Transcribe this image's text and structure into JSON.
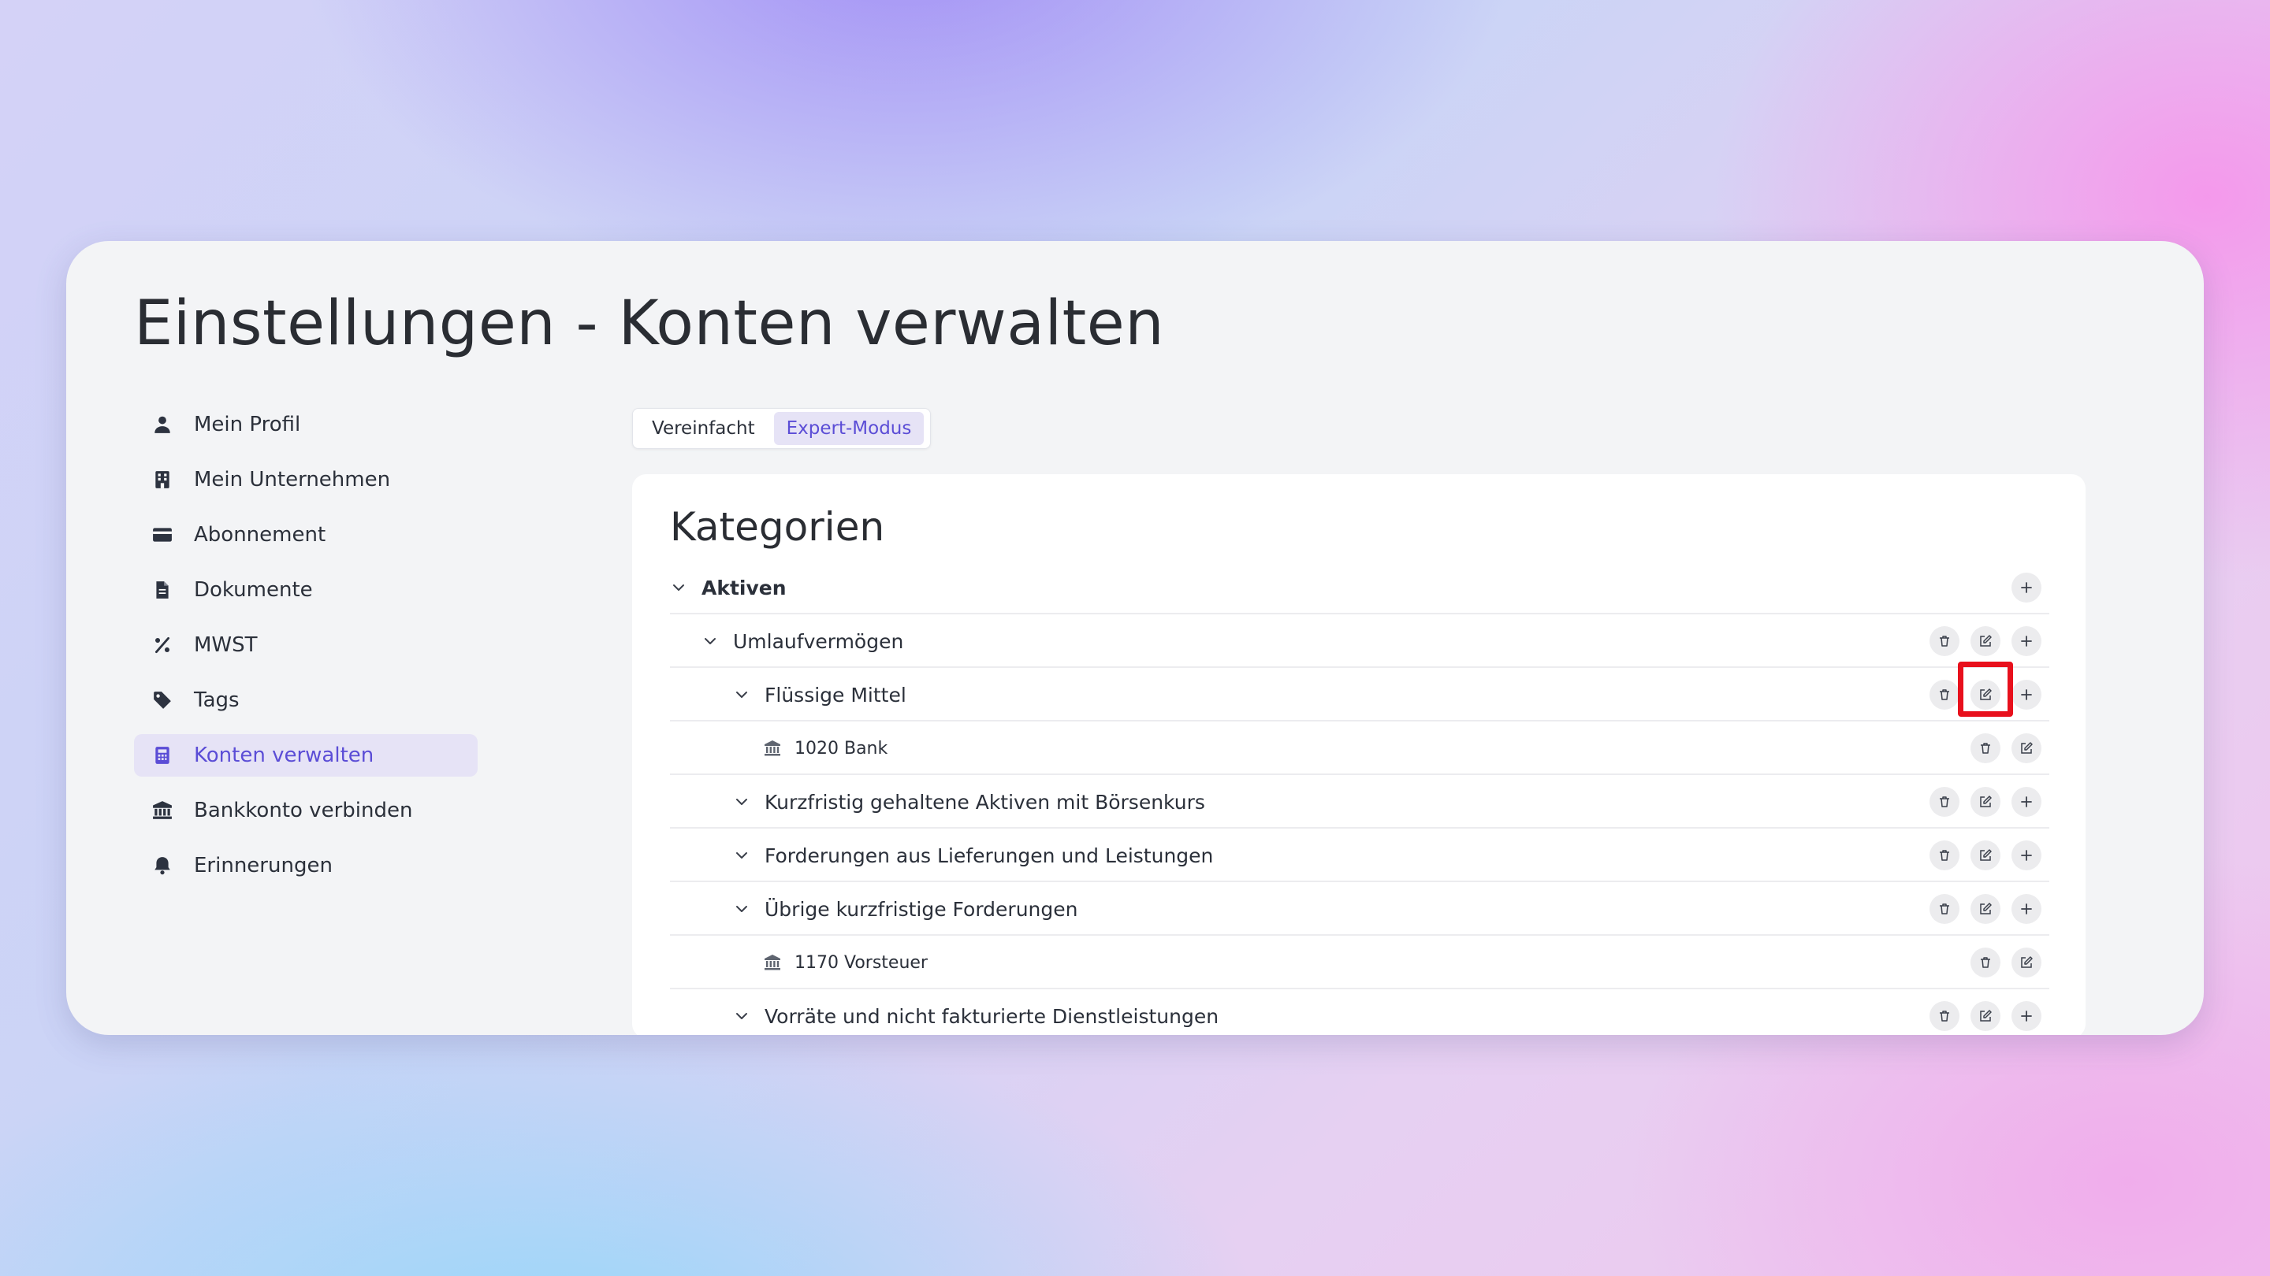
{
  "page": {
    "title": "Einstellungen - Konten verwalten"
  },
  "sidebar": {
    "items": [
      {
        "label": "Mein Profil",
        "icon": "user-icon"
      },
      {
        "label": "Mein Unternehmen",
        "icon": "building-icon"
      },
      {
        "label": "Abonnement",
        "icon": "credit-card-icon"
      },
      {
        "label": "Dokumente",
        "icon": "document-icon"
      },
      {
        "label": "MWST",
        "icon": "percent-icon"
      },
      {
        "label": "Tags",
        "icon": "tag-icon"
      },
      {
        "label": "Konten verwalten",
        "icon": "calculator-icon",
        "active": true
      },
      {
        "label": "Bankkonto verbinden",
        "icon": "bank-icon"
      },
      {
        "label": "Erinnerungen",
        "icon": "bell-icon"
      }
    ]
  },
  "mode": {
    "simple_label": "Vereinfacht",
    "expert_label": "Expert-Modus",
    "active": "expert"
  },
  "categories": {
    "title": "Kategorien",
    "rows": [
      {
        "label": "Aktiven",
        "level": 0,
        "type": "group",
        "expanded": true
      },
      {
        "label": "Umlaufvermögen",
        "level": 1,
        "type": "group",
        "expanded": true
      },
      {
        "label": "Flüssige Mittel",
        "level": 2,
        "type": "group",
        "expanded": true
      },
      {
        "label": "1020 Bank",
        "level": 3,
        "type": "account"
      },
      {
        "label": "Kurzfristig gehaltene Aktiven mit Börsenkurs",
        "level": 2,
        "type": "group",
        "expanded": true
      },
      {
        "label": "Forderungen aus Lieferungen und Leistungen",
        "level": 2,
        "type": "group",
        "expanded": true
      },
      {
        "label": "Übrige kurzfristige Forderungen",
        "level": 2,
        "type": "group",
        "expanded": true
      },
      {
        "label": "1170 Vorsteuer",
        "level": 3,
        "type": "account"
      },
      {
        "label": "Vorräte und nicht fakturierte Dienstleistungen",
        "level": 2,
        "type": "group",
        "expanded": true
      }
    ]
  },
  "colors": {
    "accent": "#5b4dd6",
    "active_bg": "#e6e3f6",
    "highlight": "#e8101c"
  }
}
